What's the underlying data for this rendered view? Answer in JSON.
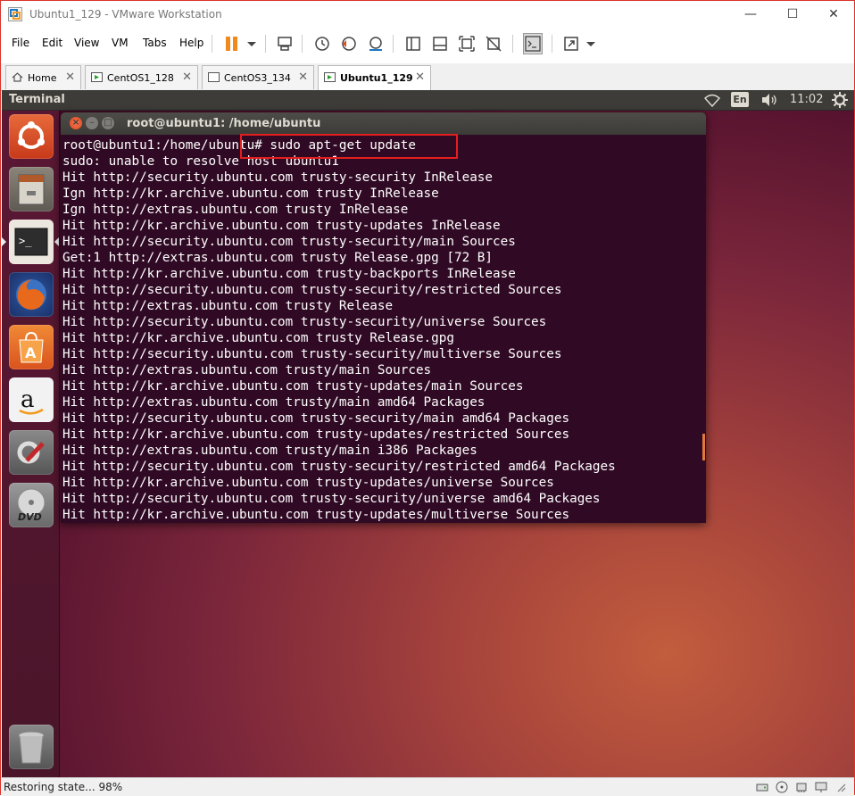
{
  "window": {
    "title": "Ubuntu1_129 - VMware Workstation"
  },
  "menu": [
    "File",
    "Edit",
    "View",
    "VM",
    "Tabs",
    "Help"
  ],
  "toolbar": {
    "icons": [
      "pause-icon",
      "send-ctrl-alt-del-icon",
      "snapshot-icon",
      "revert-snapshot-icon",
      "manage-snapshots-icon",
      "show-library-icon",
      "thumbnail-bar-icon",
      "full-screen-icon",
      "unity-icon",
      "console-view-icon",
      "fit-window-icon"
    ]
  },
  "tabs": [
    {
      "label": "Home",
      "active": false
    },
    {
      "label": "CentOS1_128",
      "active": false
    },
    {
      "label": "CentOS3_134",
      "active": false
    },
    {
      "label": "Ubuntu1_129",
      "active": true
    }
  ],
  "ubuntu": {
    "app_title": "Terminal",
    "lang": "En",
    "clock": "11:02",
    "launcher": [
      "ubuntu-dash-icon",
      "files-icon",
      "terminal-icon",
      "firefox-icon",
      "software-center-icon",
      "amazon-icon",
      "system-settings-icon",
      "dvd-icon",
      "trash-icon"
    ]
  },
  "terminal": {
    "title": "root@ubuntu1: /home/ubuntu",
    "lines": [
      "root@ubuntu1:/home/ubuntu# sudo apt-get update",
      "sudo: unable to resolve host ubuntu1",
      "Hit http://security.ubuntu.com trusty-security InRelease",
      "Ign http://kr.archive.ubuntu.com trusty InRelease",
      "Ign http://extras.ubuntu.com trusty InRelease",
      "Hit http://kr.archive.ubuntu.com trusty-updates InRelease",
      "Hit http://security.ubuntu.com trusty-security/main Sources",
      "Get:1 http://extras.ubuntu.com trusty Release.gpg [72 B]",
      "Hit http://kr.archive.ubuntu.com trusty-backports InRelease",
      "Hit http://security.ubuntu.com trusty-security/restricted Sources",
      "Hit http://extras.ubuntu.com trusty Release",
      "Hit http://security.ubuntu.com trusty-security/universe Sources",
      "Hit http://kr.archive.ubuntu.com trusty Release.gpg",
      "Hit http://security.ubuntu.com trusty-security/multiverse Sources",
      "Hit http://extras.ubuntu.com trusty/main Sources",
      "Hit http://kr.archive.ubuntu.com trusty-updates/main Sources",
      "Hit http://extras.ubuntu.com trusty/main amd64 Packages",
      "Hit http://security.ubuntu.com trusty-security/main amd64 Packages",
      "Hit http://kr.archive.ubuntu.com trusty-updates/restricted Sources",
      "Hit http://extras.ubuntu.com trusty/main i386 Packages",
      "Hit http://security.ubuntu.com trusty-security/restricted amd64 Packages",
      "Hit http://kr.archive.ubuntu.com trusty-updates/universe Sources",
      "Hit http://security.ubuntu.com trusty-security/universe amd64 Packages",
      "Hit http://kr.archive.ubuntu.com trusty-updates/multiverse Sources"
    ]
  },
  "status": {
    "text": "Restoring state... 98%"
  },
  "colors": {
    "terminal_bg": "#300a24",
    "highlight": "#e31e1e",
    "ubuntu_orange": "#dd4814"
  }
}
